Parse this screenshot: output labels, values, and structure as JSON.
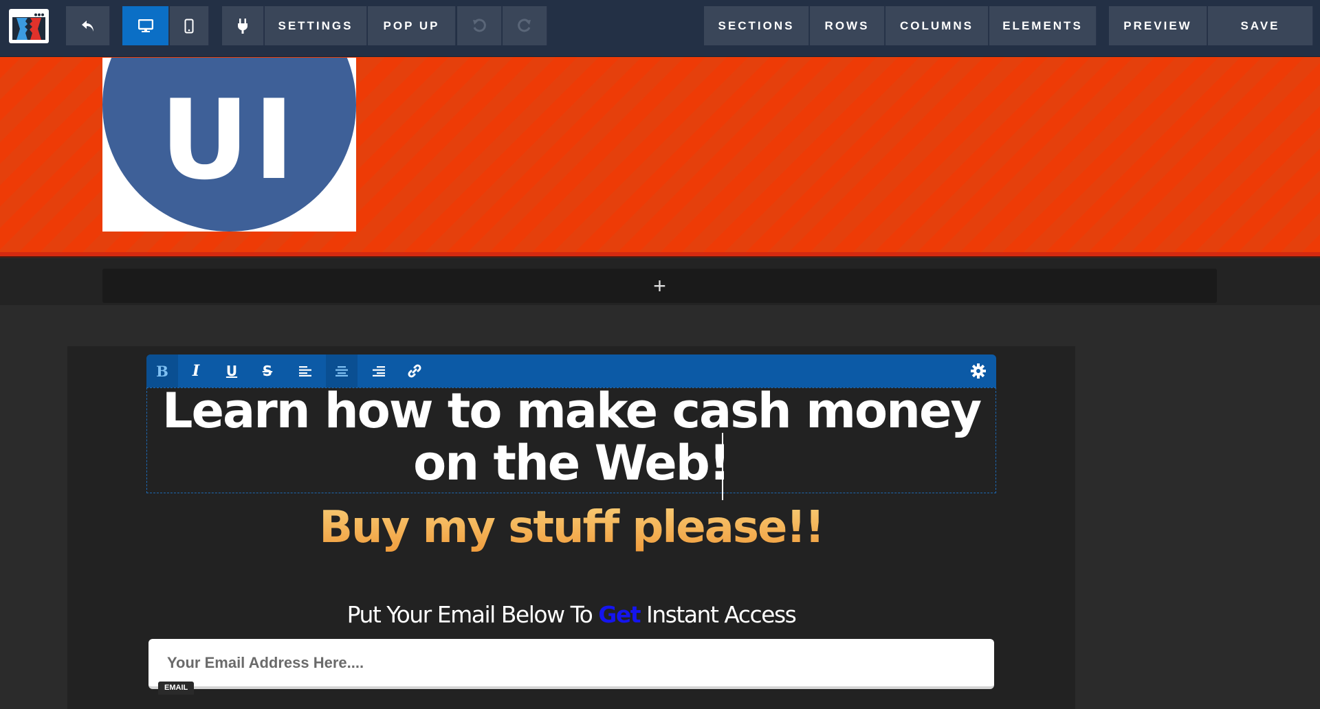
{
  "toolbar": {
    "back_icon": "back-arrow-icon",
    "device_desktop_icon": "desktop-icon",
    "device_mobile_icon": "mobile-icon",
    "plugins_icon": "plug-icon",
    "settings_label": "SETTINGS",
    "popup_label": "POP UP",
    "undo_icon": "undo-icon",
    "redo_icon": "redo-icon",
    "sections_label": "SECTIONS",
    "rows_label": "ROWS",
    "columns_label": "COLUMNS",
    "elements_label": "ELEMENTS",
    "preview_label": "PREVIEW",
    "save_label": "SAVE",
    "active_device": "desktop",
    "accent_color": "#0b6fc6"
  },
  "hero": {
    "logo_text": "UI",
    "background_color": "#ee3b06",
    "logo_circle_color": "#3e6098"
  },
  "add_section": {
    "label": "+"
  },
  "rich_text_toolbar": {
    "buttons": [
      {
        "name": "bold",
        "glyph": "B",
        "active": true
      },
      {
        "name": "italic",
        "glyph": "I",
        "active": false
      },
      {
        "name": "underline",
        "glyph": "U",
        "active": false
      },
      {
        "name": "strikethrough",
        "glyph": "S",
        "active": false
      },
      {
        "name": "align-left",
        "active": false
      },
      {
        "name": "align-center",
        "active": true
      },
      {
        "name": "align-right",
        "active": false
      },
      {
        "name": "link",
        "active": false
      }
    ],
    "settings_icon": "gear-icon"
  },
  "content": {
    "headline": "Learn how to make cash money on the Web!",
    "subheadline": "Buy my stuff please!!",
    "cta_before": "Put Your Email Below To ",
    "cta_highlight": "Get",
    "cta_after": " Instant Access",
    "cta_highlight_color": "#1515ee",
    "email_placeholder": "Your Email Address Here....",
    "email_tag": "EMAIL"
  }
}
